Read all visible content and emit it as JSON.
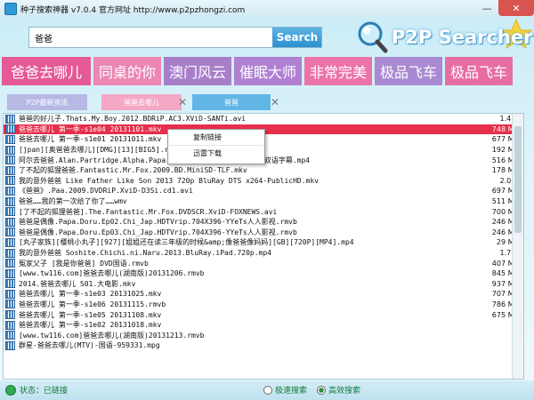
{
  "window": {
    "title": "种子搜索神器  v7.0.4  官方网址  http://www.p2pzhongzi.com",
    "minimize_icon": "minimize-icon",
    "close_icon": "close-icon"
  },
  "search": {
    "query": "爸爸",
    "button_label": "Search"
  },
  "logo": {
    "text": "P2P Searcher"
  },
  "hot_tags": [
    {
      "label": "爸爸去哪儿",
      "color": "#e55a96"
    },
    {
      "label": "同桌的你",
      "color": "#eb87b2"
    },
    {
      "label": "澳门风云",
      "color": "#a97ec9"
    },
    {
      "label": "催眠大师",
      "color": "#b081d3"
    },
    {
      "label": "非常完美",
      "color": "#ec73a8"
    },
    {
      "label": "极品飞车",
      "color": "#a98ad2"
    },
    {
      "label": "极品飞车",
      "color": "#e76ea2"
    }
  ],
  "tabs": [
    {
      "label": "P2P最新资讯",
      "color": "#b7b9e4"
    },
    {
      "label": "爸爸去哪儿",
      "color": "#f5a8c5"
    },
    {
      "label": "爸爸",
      "color": "#62b6e6"
    }
  ],
  "files": [
    {
      "name": "爸爸的好儿子.Thats.My.Boy.2012.BDRiP.AC3.XViD-SANTi.avi",
      "size": "1.4 G"
    },
    {
      "name": "爸爸去哪儿 第一季-s1e04 20131101.mkv",
      "size": "748 MB"
    },
    {
      "name": "爸爸去哪儿 第一季-s1e01 20131011.mkv",
      "size": "677 MB"
    },
    {
      "name": "[jpan][奥爸爸去哪儿][DMG][13][BIG5].rmvb",
      "size": "192 MB"
    },
    {
      "name": "阿尔去爸爸.Alan.Partridge.Alpha.Papa.2013.BD-MP4-原创翻译中英双语字幕.mp4",
      "size": "516 MB"
    },
    {
      "name": "了不起的狐狸爸爸.Fantastic.Mr.Fox.2009.BD.MiniSD-TLF.mkv",
      "size": "178 MB"
    },
    {
      "name": "我的意外爸爸 Like Father Like Son 2013 720p BluRay DTS x264-PublicHD.mkv",
      "size": "2.0 G"
    },
    {
      "name": "《爸爸》.Paa.2009.DVDRiP.XviD-D3Si.cd1.avi",
      "size": "697 MB"
    },
    {
      "name": "爸爸……我的第一次给了你了……wmv",
      "size": "511 MB"
    },
    {
      "name": "[了不起的狐狸爸爸].The.Fantastic.Mr.Fox.DVDSCR.XviD-FOXNEWS.avi",
      "size": "700 MB"
    },
    {
      "name": "爸爸是偶像.Papa.Doru.Ep02.Chi_Jap.HDTVrip.704X396-YYeTs人人影视.rmvb",
      "size": "246 MB"
    },
    {
      "name": "爸爸是偶像.Papa.Doru.Ep03.Chi_Jap.HDTVrip.704X396-YYeTs人人影视.rmvb",
      "size": "246 MB"
    },
    {
      "name": "[丸子家族][樱桃小丸子][927][姐姐还在读三年级的时候&amp;像爸爸像妈妈][GB][720P][MP4].mp4",
      "size": "29 MB"
    },
    {
      "name": "我的意外爸爸  Soshite.Chichi.ni.Naru.2013.BluRay.iPad.720p.mp4",
      "size": "1.7 G"
    },
    {
      "name": "冤家父子 [我是你爸爸]  DVD国语.rmvb",
      "size": "407 MB"
    },
    {
      "name": "[www.tw116.com]爸爸去哪儿(湖南版)20131206.rmvb",
      "size": "845 MB"
    },
    {
      "name": "2014.爸爸去哪儿 S01.大电影.mkv",
      "size": "937 MB"
    },
    {
      "name": "爸爸去哪儿 第一季-s1e03 20131025.mkv",
      "size": "707 MB"
    },
    {
      "name": "爸爸去哪儿 第一季-s1e06 20131115.rmvb",
      "size": "786 MB"
    },
    {
      "name": "爸爸去哪儿 第一季-s1e05 20131108.mkv",
      "size": "675 MB"
    },
    {
      "name": "爸爸去哪儿 第一季-s1e02 20131018.mkv",
      "size": ""
    },
    {
      "name": "[www.tw116.com]爸爸去哪儿(湖南版)20131213.rmvb",
      "size": ""
    },
    {
      "name": "群星-爸爸去哪儿(MTV)-国语-959331.mpg",
      "size": ""
    }
  ],
  "selected_index": 1,
  "context_menu": [
    "复制链接",
    "迅雷下载"
  ],
  "status": {
    "text": "状态：已链接",
    "options": [
      {
        "label": "极速搜索",
        "selected": false
      },
      {
        "label": "高效搜索",
        "selected": true
      }
    ]
  },
  "colors": {
    "selected_row": "#e62f4b",
    "accent": "#2d8fcf"
  }
}
